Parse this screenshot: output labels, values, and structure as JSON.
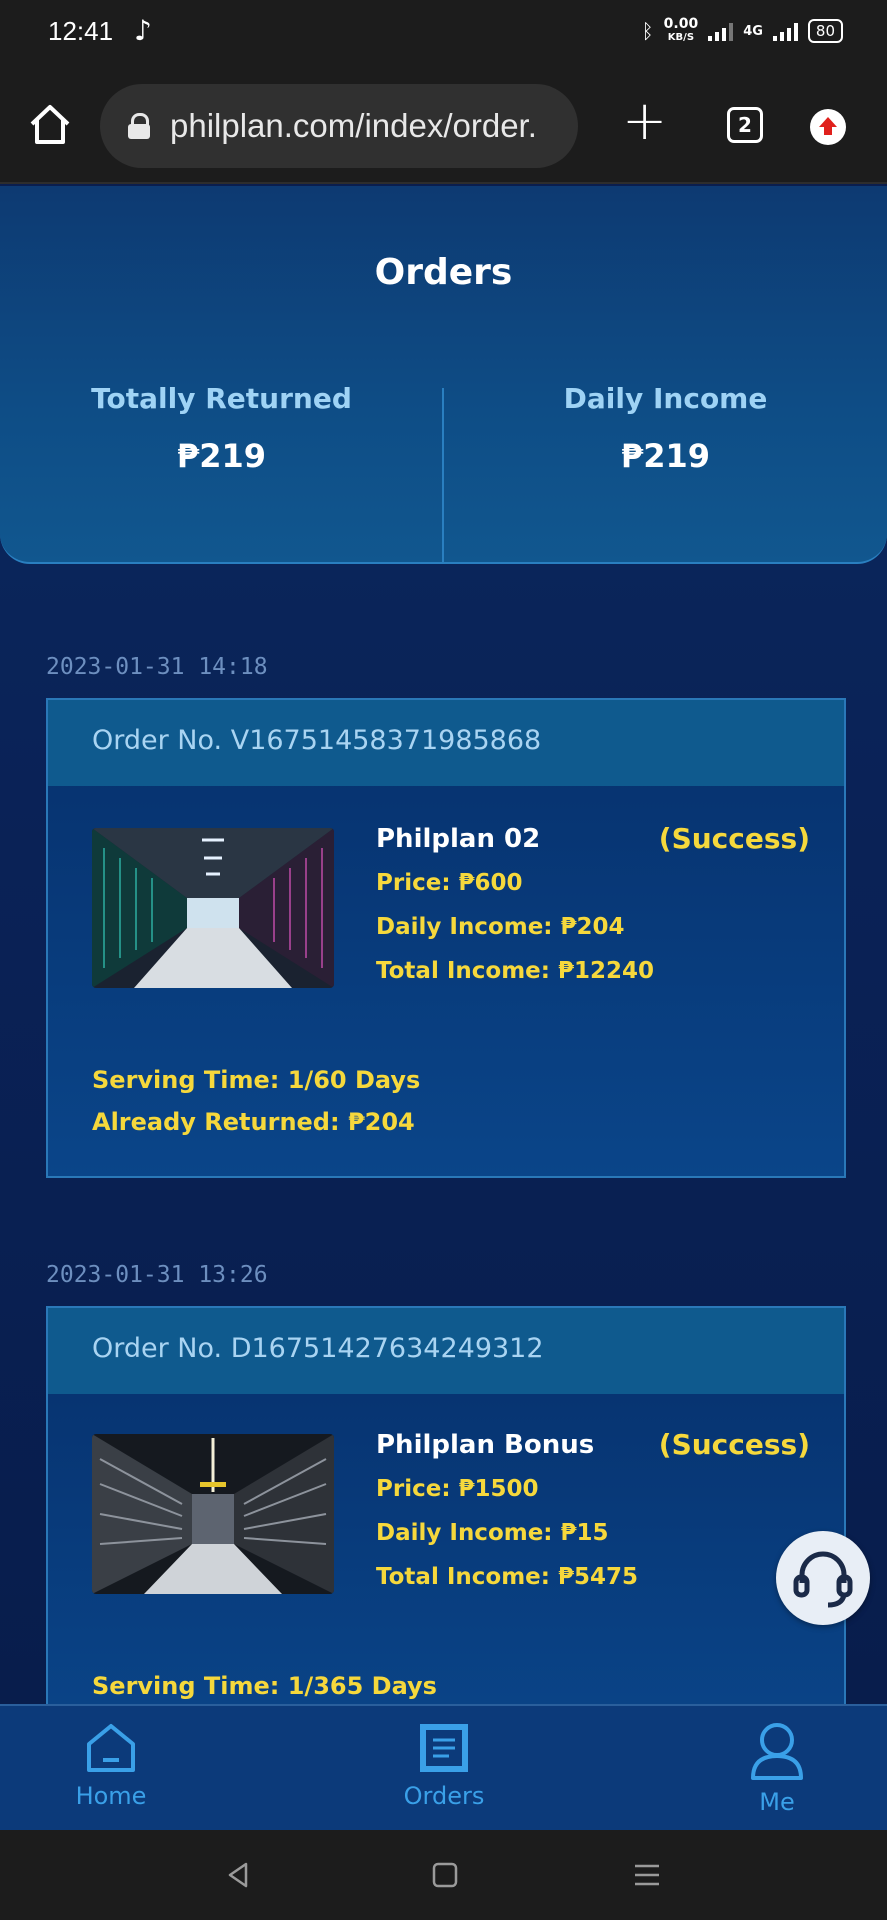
{
  "status_bar": {
    "time": "12:41",
    "net_speed_top": "0.00",
    "net_speed_bottom": "KB/S",
    "network": "4G",
    "battery": "80"
  },
  "browser": {
    "url": "philplan.com/index/order.",
    "tab_count": "2"
  },
  "page": {
    "title": "Orders",
    "totally_returned_label": "Totally Returned",
    "totally_returned_value": "₱219",
    "daily_income_label": "Daily Income",
    "daily_income_value": "₱219"
  },
  "orders": [
    {
      "date": "2023-01-31 14:18",
      "order_no": "Order No. V16751458371985868",
      "name": "Philplan 02",
      "status": "(Success)",
      "price": "Price: ₱600",
      "daily_income": "Daily Income: ₱204",
      "total_income": "Total Income: ₱12240",
      "serving_time": "Serving Time: 1/60 Days",
      "already_returned": "Already Returned: ₱204"
    },
    {
      "date": "2023-01-31 13:26",
      "order_no": "Order No. D16751427634249312",
      "name": "Philplan Bonus",
      "status": "(Success)",
      "price": "Price: ₱1500",
      "daily_income": "Daily Income: ₱15",
      "total_income": "Total Income: ₱5475",
      "serving_time": "Serving Time: 1/365 Days"
    }
  ],
  "nav": {
    "home": "Home",
    "orders": "Orders",
    "me": "Me"
  },
  "colors": {
    "accent": "#3aa0e8",
    "highlight": "#f6d83c",
    "background": "#0a2257"
  }
}
